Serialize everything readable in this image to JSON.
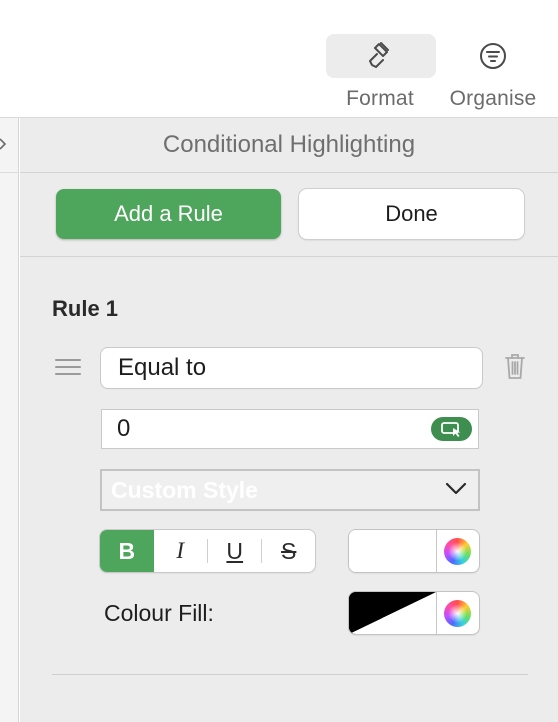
{
  "toolbar": {
    "format_label": "Format",
    "organise_label": "Organise",
    "format_icon": "paintbrush-icon",
    "organise_icon": "filter-icon"
  },
  "panel": {
    "title": "Conditional Highlighting",
    "add_rule_label": "Add a Rule",
    "done_label": "Done",
    "accent_color": "#4ea55c"
  },
  "rule": {
    "title": "Rule 1",
    "condition": "Equal to",
    "value": "0",
    "style_select": "Custom Style",
    "format_buttons": {
      "bold": "B",
      "italic": "I",
      "underline": "U",
      "strikethrough": "S"
    },
    "bold_active": true,
    "text_colour": "#ffffff",
    "fill_label": "Colour Fill:",
    "fill_colour": "#000000"
  }
}
